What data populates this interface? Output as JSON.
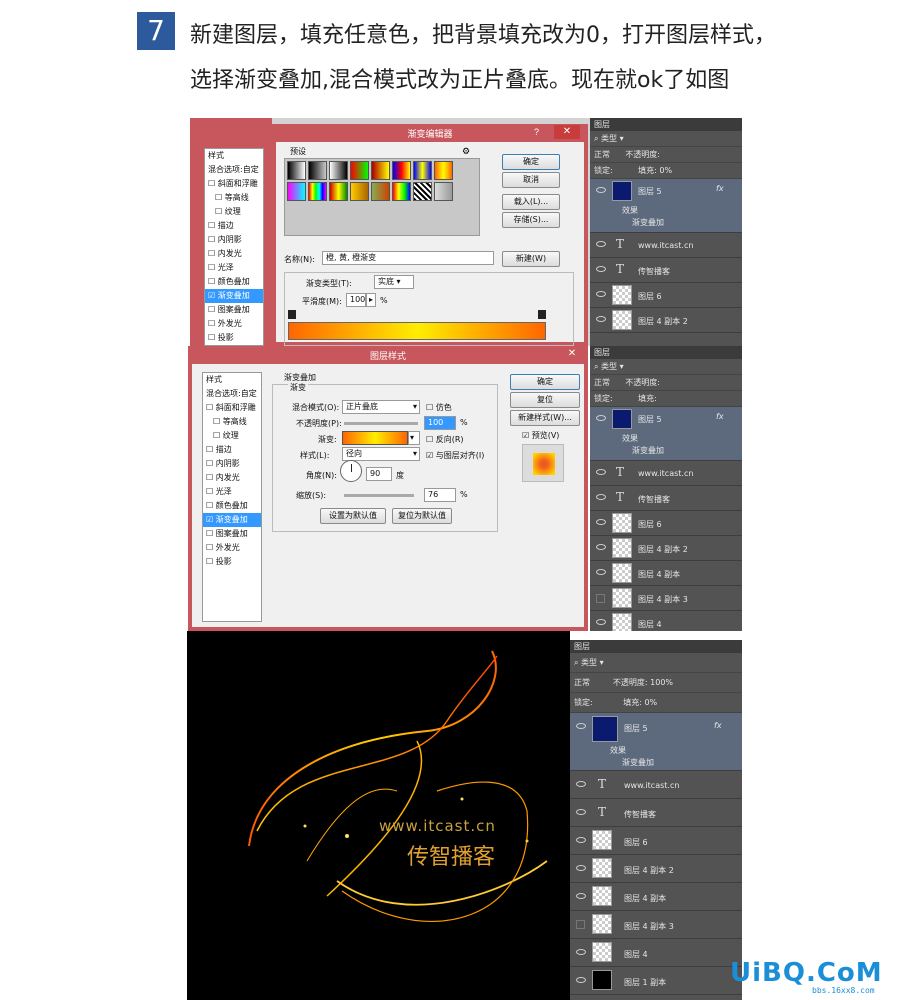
{
  "header": {
    "step_number": "7",
    "line1": "新建图层，填充任意色，把背景填充改为0，打开图层样式，",
    "line2": "选择渐变叠加,混合模式改为正片叠底。现在就ok了如图"
  },
  "styles_list": {
    "title": "样式",
    "items": [
      "混合选项:自定",
      "斜面和浮雕",
      "等高线",
      "纹理",
      "描边",
      "内阴影",
      "内发光",
      "光泽",
      "颜色叠加",
      "渐变叠加",
      "图案叠加",
      "外发光",
      "投影"
    ],
    "selected": "渐变叠加"
  },
  "gradient_editor": {
    "title": "渐变编辑器",
    "presets_label": "预设",
    "ok": "确定",
    "cancel": "取消",
    "load": "载入(L)...",
    "save": "存储(S)...",
    "name_label": "名称(N):",
    "name_value": "橙, 黄, 橙渐变",
    "new_button": "新建(W)",
    "type_label": "渐变类型(T):",
    "type_value": "实底",
    "smooth_label": "平滑度(M):",
    "smooth_value": "100",
    "smooth_unit": "%",
    "gradient_start": "#ff6600",
    "gradient_mid": "#ffee00",
    "gradient_end": "#ff6600"
  },
  "layer_style": {
    "title": "图层样式",
    "section": "渐变叠加",
    "subsection": "渐变",
    "blend_label": "混合模式(O):",
    "blend_value": "正片叠底",
    "dither_label": "仿色",
    "opacity_label": "不透明度(P):",
    "opacity_value": "100",
    "gradient_label": "渐变:",
    "reverse_label": "反向(R)",
    "style_label": "样式(L):",
    "style_value": "径向",
    "align_label": "与图层对齐(I)",
    "angle_label": "角度(N):",
    "angle_value": "90",
    "angle_unit": "度",
    "scale_label": "缩放(S):",
    "scale_value": "76",
    "percent": "%",
    "set_default": "设置为默认值",
    "reset_default": "复位为默认值",
    "ok": "确定",
    "reset": "复位",
    "new_style": "新建样式(W)...",
    "preview_label": "预览(V)"
  },
  "layers_panel": {
    "tab": "图层",
    "filter": "类型",
    "blend_mode": "正常",
    "opacity_label": "不透明度:",
    "opacity_value": "100%",
    "lock_label": "锁定:",
    "fill_label": "填充:",
    "fill_value": "0%",
    "effects_label": "效果",
    "effect_item": "渐变叠加",
    "fx": "fx",
    "layers": [
      "图层 5",
      "www.itcast.cn",
      "传智播客",
      "图层 6",
      "图层 4 副本 2",
      "图层 4 副本",
      "图层 4 副本 3",
      "图层 4",
      "图层 1 副本"
    ]
  },
  "canvas": {
    "url_text": "www.itcast.cn",
    "brand_text": "传智播客"
  },
  "watermark": {
    "logo": "UiBQ.CoM",
    "sub": "bbs.16xx8.com"
  }
}
